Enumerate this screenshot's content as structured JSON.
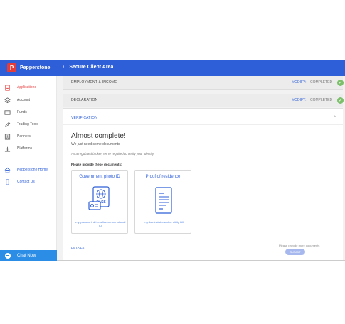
{
  "header": {
    "brand": "Pepperstone",
    "logo_letter": "P",
    "back_icon": "chevron-left-icon",
    "title": "Secure Client Area",
    "bg_color": "#2f5fd8"
  },
  "sidebar": {
    "items": [
      {
        "label": "Applications",
        "icon": "document-icon",
        "active": true
      },
      {
        "label": "Account",
        "icon": "layers-icon"
      },
      {
        "label": "Funds",
        "icon": "wallet-icon"
      },
      {
        "label": "Trading Tools",
        "icon": "pencil-icon"
      },
      {
        "label": "Partners",
        "icon": "person-icon"
      },
      {
        "label": "Platforms",
        "icon": "chart-icon"
      },
      {
        "label": "Pepperstone Home",
        "icon": "home-icon"
      },
      {
        "label": "Contact Us",
        "icon": "phone-icon"
      }
    ],
    "chat_label": "Chat Now"
  },
  "steps": [
    {
      "title": "EMPLOYMENT & INCOME",
      "modify": "MODIFY:",
      "status": "COMPLETED"
    },
    {
      "title": "DECLARATION",
      "modify": "MODIFY:",
      "status": "COMPLETED"
    }
  ],
  "verification": {
    "header": "VERIFICATION",
    "heading": "Almost complete!",
    "subheading": "We just need some documents",
    "italic_note": "As a regulated broker, we're required to verify your identity",
    "please_provide": "Please provide these documents:",
    "documents": [
      {
        "title": "Government photo ID",
        "note": "e.g. passport, drivers licence or national ID",
        "icon": "passport-icon"
      },
      {
        "title": "Proof of residence",
        "note": "e.g. bank statement or utility bill",
        "icon": "bill-icon"
      }
    ],
    "details_link": "DETAILS",
    "please_upload_msg": "Please provide more documents",
    "submit_label": "SUBMIT"
  },
  "colors": {
    "accent": "#2f5fd8",
    "active": "#e43b3b",
    "success": "#7cc06c",
    "chat": "#2b8de6"
  }
}
